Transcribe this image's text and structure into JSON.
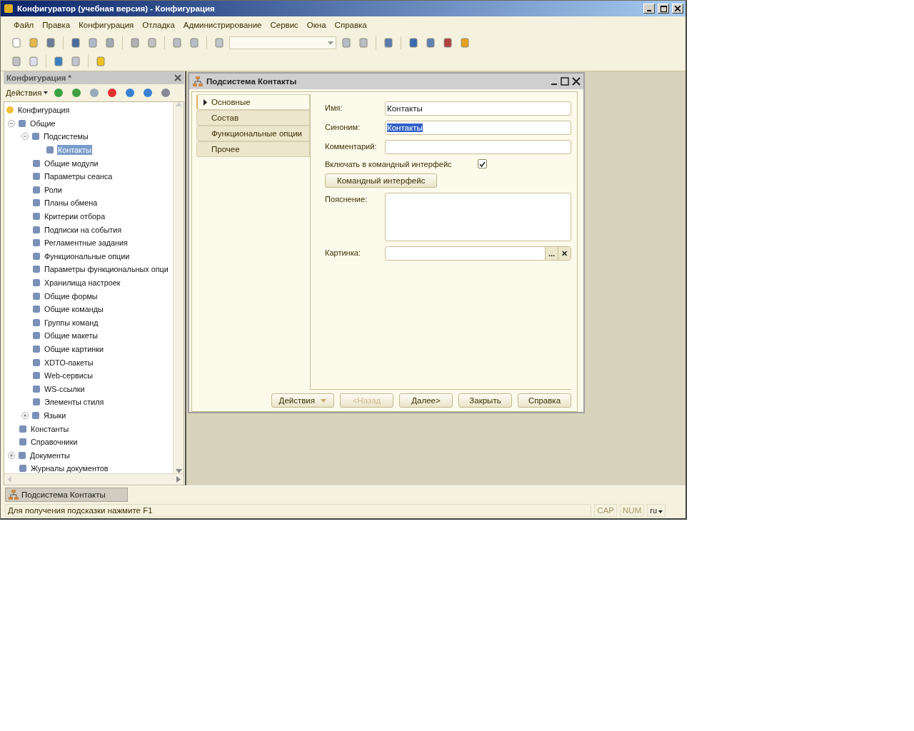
{
  "window": {
    "title": "Конфигуратор (учебная версия) - Конфигурация"
  },
  "menu": [
    "Файл",
    "Правка",
    "Конфигурация",
    "Отладка",
    "Администрирование",
    "Сервис",
    "Окна",
    "Справка"
  ],
  "config_panel": {
    "title": "Конфигурация *",
    "actions_label": "Действия",
    "tree": [
      {
        "label": "Конфигурация",
        "selected": false,
        "children": [
          {
            "label": "Общие",
            "selected": false,
            "expanded": true,
            "children": [
              {
                "label": "Подсистемы",
                "selected": false,
                "expanded": true,
                "children": [
                  {
                    "label": "Контакты",
                    "selected": true
                  }
                ]
              },
              {
                "label": "Общие модули",
                "selected": false
              },
              {
                "label": "Параметры сеанса",
                "selected": false
              },
              {
                "label": "Роли",
                "selected": false
              },
              {
                "label": "Планы обмена",
                "selected": false
              },
              {
                "label": "Критерии отбора",
                "selected": false
              },
              {
                "label": "Подписки на события",
                "selected": false
              },
              {
                "label": "Регламентные задания",
                "selected": false
              },
              {
                "label": "Функциональные опции",
                "selected": false
              },
              {
                "label": "Параметры функциональных опци",
                "selected": false
              },
              {
                "label": "Хранилища настроек",
                "selected": false
              },
              {
                "label": "Общие формы",
                "selected": false
              },
              {
                "label": "Общие команды",
                "selected": false
              },
              {
                "label": "Группы команд",
                "selected": false
              },
              {
                "label": "Общие макеты",
                "selected": false
              },
              {
                "label": "Общие картинки",
                "selected": false
              },
              {
                "label": "XDTO-пакеты",
                "selected": false
              },
              {
                "label": "Web-сервисы",
                "selected": false
              },
              {
                "label": "WS-ссылки",
                "selected": false
              },
              {
                "label": "Элементы стиля",
                "selected": false
              },
              {
                "label": "Языки",
                "selected": false,
                "expanded": false
              }
            ]
          },
          {
            "label": "Константы",
            "selected": false
          },
          {
            "label": "Справочники",
            "selected": false
          },
          {
            "label": "Документы",
            "selected": false,
            "expanded": false
          },
          {
            "label": "Журналы документов",
            "selected": false
          }
        ]
      }
    ]
  },
  "dialog": {
    "title": "Подсистема Контакты",
    "sections": [
      {
        "label": "Основные",
        "selected": true
      },
      {
        "label": "Состав",
        "selected": false
      },
      {
        "label": "Функциональные опции",
        "selected": false
      },
      {
        "label": "Прочее",
        "selected": false
      }
    ],
    "fields": [
      {
        "label": "Имя:",
        "value": "Контакты",
        "highlighted": false
      },
      {
        "label": "Синоним:",
        "value": "Контакты",
        "highlighted": true
      },
      {
        "label": "Комментарий:"
      }
    ],
    "include_checkbox": {
      "label": "Включать в командный интерфейс",
      "checked": true
    },
    "command_interface_button": "Командный интерфейс",
    "explanation": {
      "label": "Пояснение:"
    },
    "picture": {
      "label": "Картинка:",
      "select": "...",
      "clear": "✕"
    },
    "buttons": [
      {
        "label": "Действия",
        "kind": "dropdown",
        "disabled": false
      },
      {
        "label": "<Назад",
        "kind": "plain",
        "disabled": true
      },
      {
        "label": "Далее>",
        "kind": "plain",
        "disabled": false
      },
      {
        "label": "Закрыть",
        "kind": "plain",
        "disabled": false
      },
      {
        "label": "Справка",
        "kind": "plain",
        "disabled": false
      }
    ]
  },
  "taskbar": [
    {
      "label": "Подсистема Контакты",
      "selected": true
    }
  ],
  "status_bar": {
    "hint": "Для получения подсказки нажмите F1",
    "indicators": [
      "CAP",
      "NUM"
    ],
    "language": "ru"
  }
}
